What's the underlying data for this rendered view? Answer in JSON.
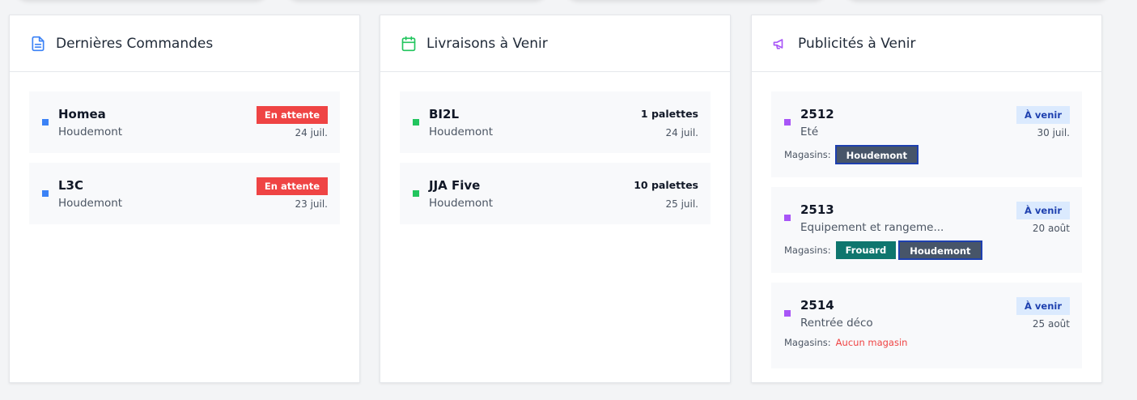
{
  "colors": {
    "blue": "#3b82f6",
    "green": "#22c55e",
    "purple": "#a855f7",
    "red": "#ef4444",
    "badge_blue_bg": "#dbeafe",
    "store_dark": "#475569",
    "store_teal": "#0f766e"
  },
  "orders": {
    "title": "Dernières Commandes",
    "icon": "document-icon",
    "items": [
      {
        "name": "Homea",
        "store": "Houdemont",
        "status": "En attente",
        "date": "24 juil."
      },
      {
        "name": "L3C",
        "store": "Houdemont",
        "status": "En attente",
        "date": "23 juil."
      }
    ]
  },
  "deliveries": {
    "title": "Livraisons à Venir",
    "icon": "calendar-icon",
    "items": [
      {
        "name": "BI2L",
        "store": "Houdemont",
        "pallets": "1 palettes",
        "date": "24 juil."
      },
      {
        "name": "JJA Five",
        "store": "Houdemont",
        "pallets": "10 palettes",
        "date": "25 juil."
      }
    ]
  },
  "ads": {
    "title": "Publicités à Venir",
    "icon": "megaphone-icon",
    "stores_label": "Magasins:",
    "no_store": "Aucun magasin",
    "items": [
      {
        "name": "2512",
        "desc": "Eté",
        "status": "À venir",
        "date": "30 juil.",
        "stores": [
          "Houdemont"
        ]
      },
      {
        "name": "2513",
        "desc": "Equipement et rangeme...",
        "status": "À venir",
        "date": "20 août",
        "stores": [
          "Frouard",
          "Houdemont"
        ]
      },
      {
        "name": "2514",
        "desc": "Rentrée déco",
        "status": "À venir",
        "date": "25 août",
        "stores": []
      }
    ]
  }
}
